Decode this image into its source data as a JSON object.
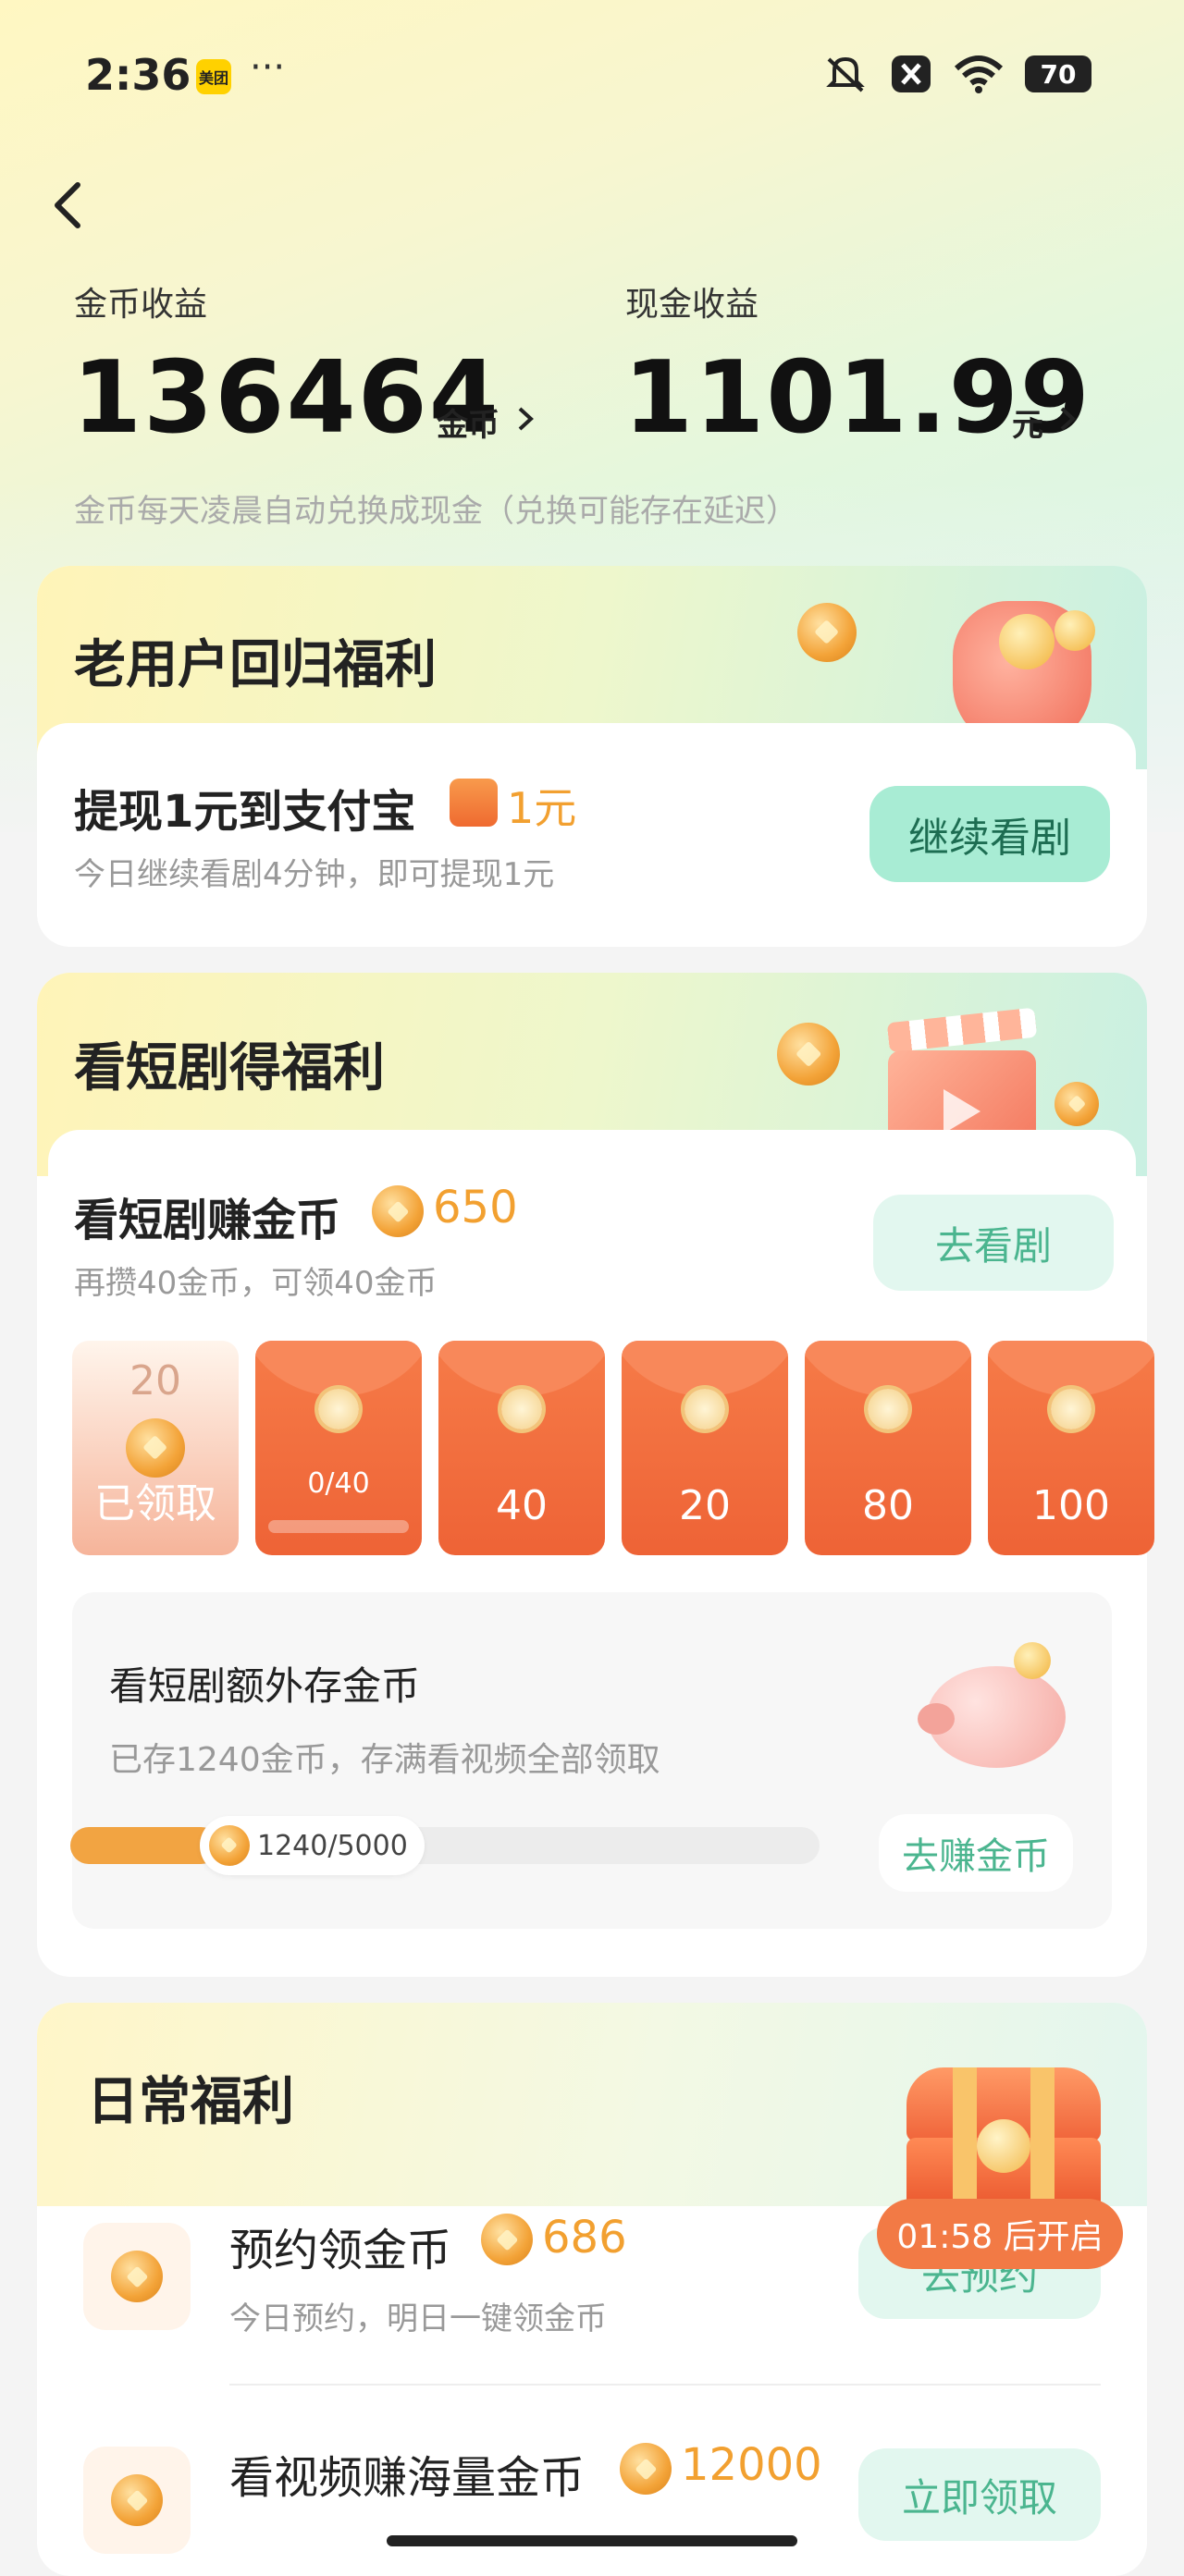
{
  "status_bar": {
    "time": "2:36",
    "app_badge": "美团",
    "more": "···",
    "battery": "70"
  },
  "earnings": {
    "coin_label": "金币收益",
    "coin_value": "136464",
    "coin_unit": "金币",
    "cash_label": "现金收益",
    "cash_value": "1101.99",
    "cash_unit": "元",
    "note": "金币每天凌晨自动兑换成现金（兑换可能存在延迟）"
  },
  "return_card": {
    "title": "老用户回归福利",
    "task_title": "提现1元到支付宝",
    "reward": "1元",
    "desc": "今日继续看剧4分钟，即可提现1元",
    "button": "继续看剧"
  },
  "drama_card": {
    "title": "看短剧得福利",
    "task_title": "看短剧赚金币",
    "coins": "650",
    "desc": "再攒40金币，可领40金币",
    "button": "去看剧",
    "envelopes": [
      {
        "top": "20",
        "label": "已领取",
        "state": "claimed"
      },
      {
        "label": "0/40",
        "state": "in_progress"
      },
      {
        "label": "40"
      },
      {
        "label": "20"
      },
      {
        "label": "80"
      },
      {
        "label": "100"
      }
    ],
    "extra": {
      "title": "看短剧额外存金币",
      "desc": "已存1240金币，存满看视频全部领取",
      "progress_text": "1240/5000",
      "progress": 0.248,
      "button": "去赚金币"
    }
  },
  "daily_card": {
    "title": "日常福利",
    "items": [
      {
        "title": "预约领金币",
        "coins": "686",
        "desc": "今日预约，明日一键领金币",
        "button": "去预约"
      },
      {
        "title": "看视频赚海量金币",
        "coins": "12000",
        "button": "立即领取"
      }
    ],
    "chest_timer": "01:58 后开启"
  },
  "colors": {
    "accent_orange": "#f27a45",
    "coin_orange": "#f2a442",
    "green_button": "#a8ecd4"
  }
}
